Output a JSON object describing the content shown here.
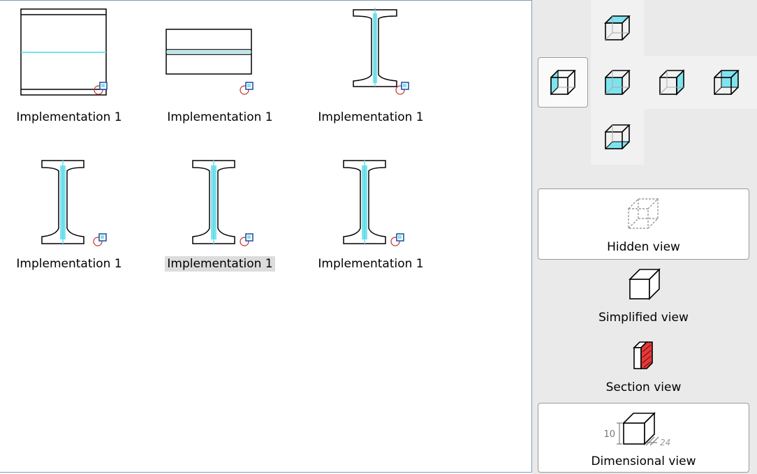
{
  "gallery": {
    "items": [
      {
        "label": "Implementation 1",
        "shape": "box-tall"
      },
      {
        "label": "Implementation 1",
        "shape": "box-wide"
      },
      {
        "label": "Implementation 1",
        "shape": "i-beam-narrow"
      },
      {
        "label": "Implementation 1",
        "shape": "i-beam-wide"
      },
      {
        "label": "Implementation 1",
        "shape": "i-beam-wide",
        "selected": true
      },
      {
        "label": "Implementation 1",
        "shape": "i-beam-wide"
      }
    ]
  },
  "view_panel": {
    "orientation_buttons": [
      "top-view",
      "left-view",
      "front-view",
      "right-view",
      "back-view",
      "bottom-view"
    ],
    "active_orientation": "left-view",
    "modes": [
      {
        "label": "Hidden view",
        "icon": "hidden-cube-icon"
      },
      {
        "label": "Simplified view",
        "icon": "simplified-cube-icon"
      },
      {
        "label": "Section view",
        "icon": "section-cube-icon"
      },
      {
        "label": "Dimensional view",
        "icon": "dimensional-cube-icon",
        "dim_height": "10",
        "dim_depth": "24"
      }
    ]
  },
  "colors": {
    "accent": "#7fe3ee",
    "section": "#e23b3b",
    "border": "#7f9db9"
  }
}
